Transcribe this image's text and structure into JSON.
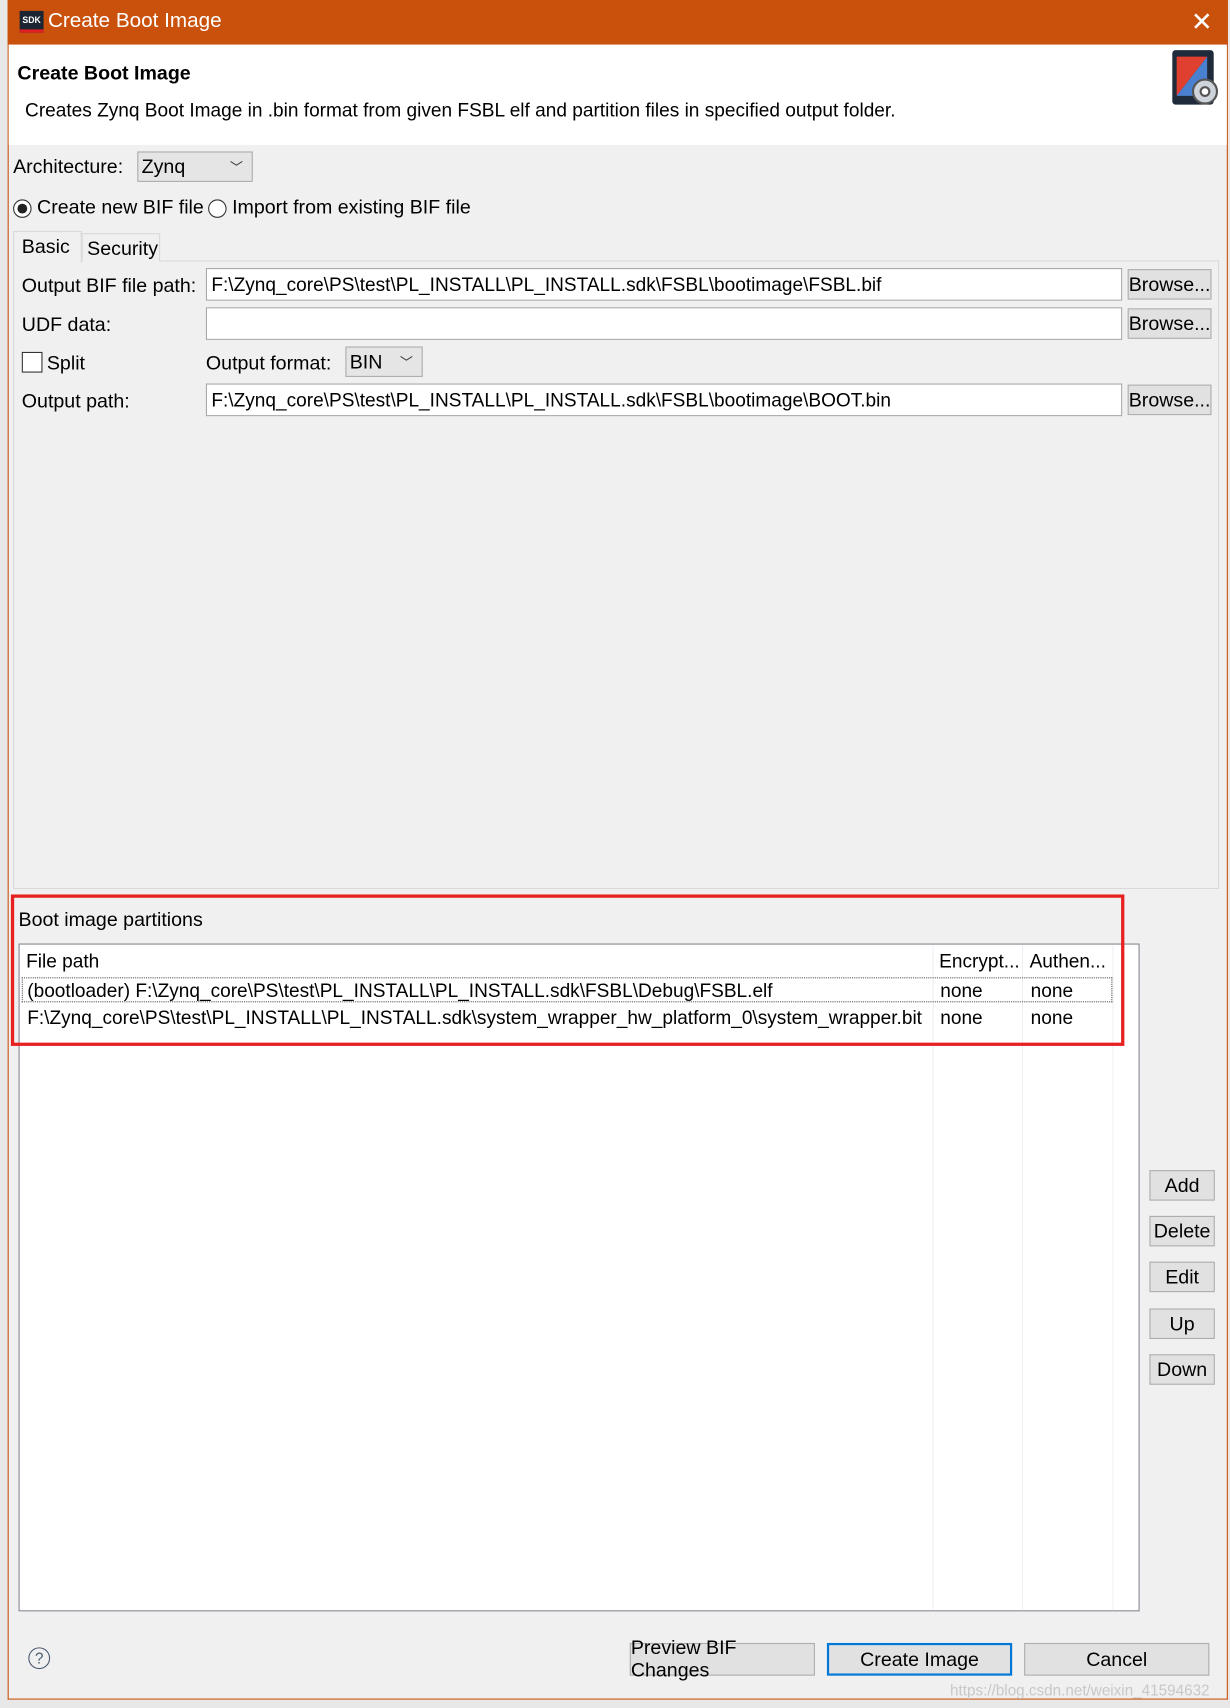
{
  "window": {
    "title": "Create Boot Image",
    "icon": "sdk-icon",
    "close_icon": "close-icon",
    "accent": "#C9510C"
  },
  "header": {
    "title": "Create Boot Image",
    "description": "Creates Zynq Boot Image in .bin format from given FSBL elf and partition files in specified output folder.",
    "icon": "boot-image-gear-icon"
  },
  "architecture": {
    "label": "Architecture:",
    "value": "Zynq"
  },
  "bif_mode": {
    "options": [
      {
        "label": "Create new BIF file",
        "selected": true
      },
      {
        "label": "Import from existing BIF file",
        "selected": false
      }
    ]
  },
  "tabs": [
    {
      "label": "Basic",
      "selected": true
    },
    {
      "label": "Security",
      "selected": false
    }
  ],
  "basic": {
    "output_bif_label": "Output BIF file path:",
    "output_bif_value": "F:\\Zynq_core\\PS\\test\\PL_INSTALL\\PL_INSTALL.sdk\\FSBL\\bootimage\\FSBL.bif",
    "udf_label": "UDF data:",
    "udf_value": "",
    "split_label": "Split",
    "split_checked": false,
    "output_format_label": "Output format:",
    "output_format_value": "BIN",
    "output_path_label": "Output path:",
    "output_path_value": "F:\\Zynq_core\\PS\\test\\PL_INSTALL\\PL_INSTALL.sdk\\FSBL\\bootimage\\BOOT.bin",
    "browse_label": "Browse..."
  },
  "partitions": {
    "label": "Boot image partitions",
    "columns": [
      "File path",
      "Encrypt...",
      "Authen..."
    ],
    "rows": [
      [
        "(bootloader) F:\\Zynq_core\\PS\\test\\PL_INSTALL\\PL_INSTALL.sdk\\FSBL\\Debug\\FSBL.elf",
        "none",
        "none"
      ],
      [
        "F:\\Zynq_core\\PS\\test\\PL_INSTALL\\PL_INSTALL.sdk\\system_wrapper_hw_platform_0\\system_wrapper.bit",
        "none",
        "none"
      ]
    ],
    "buttons": [
      "Add",
      "Delete",
      "Edit",
      "Up",
      "Down"
    ],
    "highlight_color": "#E82020"
  },
  "footer": {
    "help_icon": "help-icon",
    "preview_label": "Preview BIF Changes",
    "create_label": "Create Image",
    "cancel_label": "Cancel"
  },
  "watermark": "https://blog.csdn.net/weixin_41594632"
}
